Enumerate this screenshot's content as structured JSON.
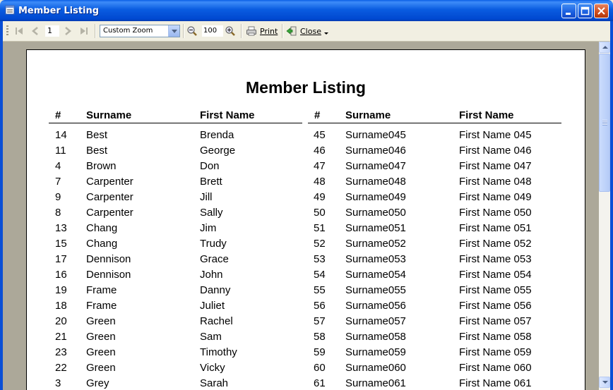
{
  "window": {
    "title": "Member Listing"
  },
  "toolbar": {
    "page_number": "1",
    "zoom_mode": "Custom Zoom",
    "zoom_value": "100",
    "print_label": "Print",
    "close_label": "Close"
  },
  "report": {
    "title": "Member Listing",
    "headers": {
      "num": "#",
      "surname": "Surname",
      "first_name": "First Name"
    },
    "left_rows": [
      [
        "14",
        "Best",
        "Brenda"
      ],
      [
        "11",
        "Best",
        "George"
      ],
      [
        "4",
        "Brown",
        "Don"
      ],
      [
        "7",
        "Carpenter",
        "Brett"
      ],
      [
        "9",
        "Carpenter",
        "Jill"
      ],
      [
        "8",
        "Carpenter",
        "Sally"
      ],
      [
        "13",
        "Chang",
        "Jim"
      ],
      [
        "15",
        "Chang",
        "Trudy"
      ],
      [
        "17",
        "Dennison",
        "Grace"
      ],
      [
        "16",
        "Dennison",
        "John"
      ],
      [
        "19",
        "Frame",
        "Danny"
      ],
      [
        "18",
        "Frame",
        "Juliet"
      ],
      [
        "20",
        "Green",
        "Rachel"
      ],
      [
        "21",
        "Green",
        "Sam"
      ],
      [
        "23",
        "Green",
        "Timothy"
      ],
      [
        "22",
        "Green",
        "Vicky"
      ],
      [
        "3",
        "Grey",
        "Sarah"
      ]
    ],
    "right_rows": [
      [
        "45",
        "Surname045",
        "First Name 045"
      ],
      [
        "46",
        "Surname046",
        "First Name 046"
      ],
      [
        "47",
        "Surname047",
        "First Name 047"
      ],
      [
        "48",
        "Surname048",
        "First Name 048"
      ],
      [
        "49",
        "Surname049",
        "First Name 049"
      ],
      [
        "50",
        "Surname050",
        "First Name 050"
      ],
      [
        "51",
        "Surname051",
        "First Name 051"
      ],
      [
        "52",
        "Surname052",
        "First Name 052"
      ],
      [
        "53",
        "Surname053",
        "First Name 053"
      ],
      [
        "54",
        "Surname054",
        "First Name 054"
      ],
      [
        "55",
        "Surname055",
        "First Name 055"
      ],
      [
        "56",
        "Surname056",
        "First Name 056"
      ],
      [
        "57",
        "Surname057",
        "First Name 057"
      ],
      [
        "58",
        "Surname058",
        "First Name 058"
      ],
      [
        "59",
        "Surname059",
        "First Name 059"
      ],
      [
        "60",
        "Surname060",
        "First Name 060"
      ],
      [
        "61",
        "Surname061",
        "First Name 061"
      ]
    ]
  }
}
